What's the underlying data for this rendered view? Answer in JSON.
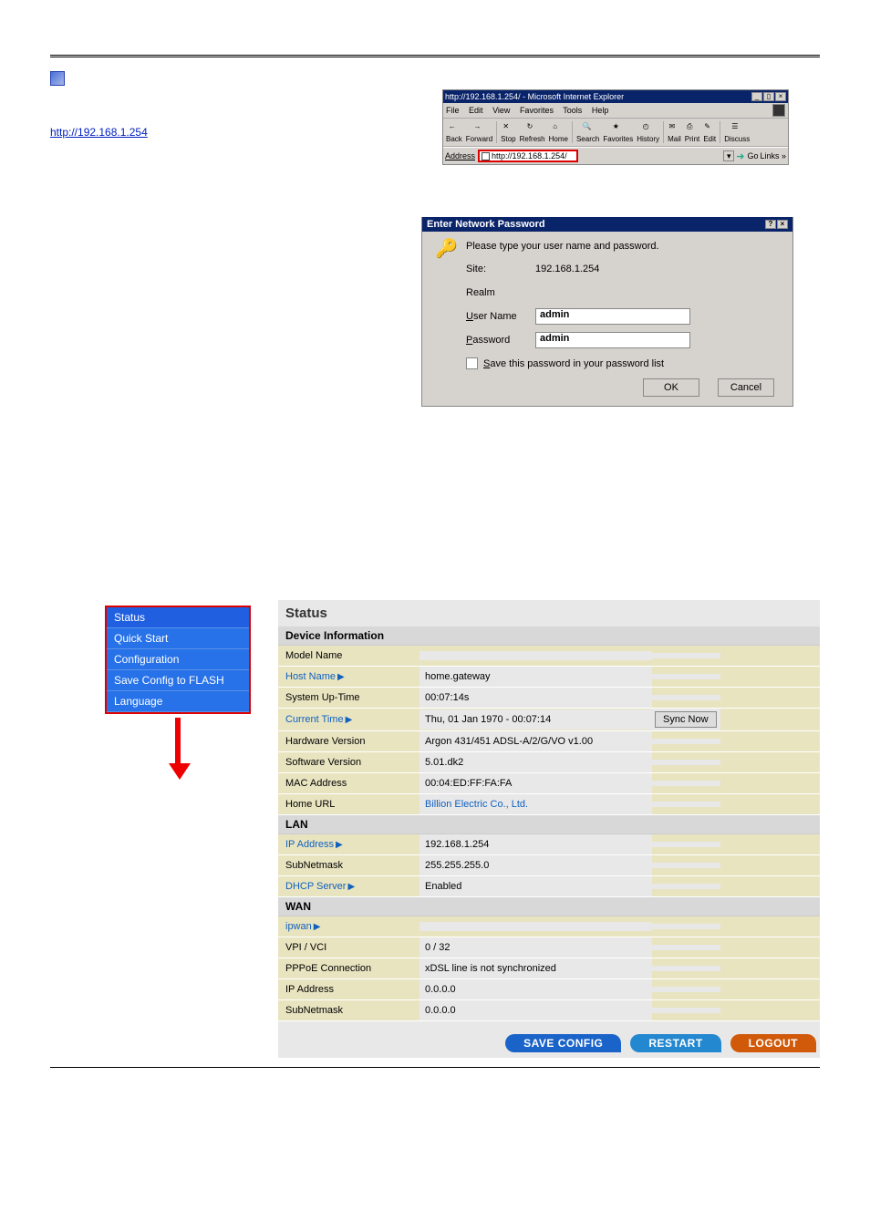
{
  "doc": {
    "intro_link_text_1": "",
    "url_link": "http://192.168.1.254"
  },
  "browser": {
    "title": "http://192.168.1.254/ - Microsoft Internet Explorer",
    "menu": {
      "file": "File",
      "edit": "Edit",
      "view": "View",
      "favorites": "Favorites",
      "tools": "Tools",
      "help": "Help"
    },
    "toolbar": {
      "back": "Back",
      "forward": "Forward",
      "stop": "Stop",
      "refresh": "Refresh",
      "home": "Home",
      "search": "Search",
      "favorites": "Favorites",
      "history": "History",
      "mail": "Mail",
      "print": "Print",
      "edit": "Edit",
      "discuss": "Discuss"
    },
    "address_label": "Address",
    "address_value": "http://192.168.1.254/",
    "go": "Go",
    "links": "Links »"
  },
  "auth": {
    "title": "Enter Network Password",
    "prompt": "Please type your user name and password.",
    "site_label": "Site:",
    "site_value": "192.168.1.254",
    "realm_label": "Realm",
    "user_label": "User Name",
    "user_value": "admin",
    "pass_label": "Password",
    "pass_value": "admin",
    "save_label": "Save this password in your password list",
    "ok": "OK",
    "cancel": "Cancel"
  },
  "sidebar": {
    "items": [
      {
        "label": "Status"
      },
      {
        "label": "Quick Start"
      },
      {
        "label": "Configuration"
      },
      {
        "label": "Save Config to FLASH"
      },
      {
        "label": "Language"
      }
    ]
  },
  "status": {
    "title": "Status",
    "section_device": "Device Information",
    "model_name_l": "Model Name",
    "model_name_v": "",
    "host_name_l": "Host Name",
    "host_name_v": "home.gateway",
    "uptime_l": "System Up-Time",
    "uptime_v": "00:07:14s",
    "curtime_l": "Current Time",
    "curtime_v": "Thu, 01 Jan 1970 - 00:07:14",
    "sync_btn": "Sync Now",
    "hwver_l": "Hardware Version",
    "hwver_v": "Argon 431/451 ADSL-A/2/G/VO v1.00",
    "swver_l": "Software Version",
    "swver_v": "5.01.dk2",
    "mac_l": "MAC Address",
    "mac_v": "00:04:ED:FF:FA:FA",
    "homeurl_l": "Home URL",
    "homeurl_v": "Billion Electric Co., Ltd.",
    "section_lan": "LAN",
    "lan_ip_l": "IP Address",
    "lan_ip_v": "192.168.1.254",
    "lan_mask_l": "SubNetmask",
    "lan_mask_v": "255.255.255.0",
    "dhcp_l": "DHCP Server",
    "dhcp_v": "Enabled",
    "section_wan": "WAN",
    "ipwan_l": "ipwan",
    "vpi_l": "VPI / VCI",
    "vpi_v": "0  /  32",
    "pppoe_l": "PPPoE Connection",
    "pppoe_v": "xDSL line is not synchronized",
    "wan_ip_l": "IP Address",
    "wan_ip_v": "0.0.0.0",
    "wan_mask_l": "SubNetmask",
    "wan_mask_v": "0.0.0.0"
  },
  "footer": {
    "save": "SAVE CONFIG",
    "restart": "RESTART",
    "logout": "LOGOUT"
  }
}
